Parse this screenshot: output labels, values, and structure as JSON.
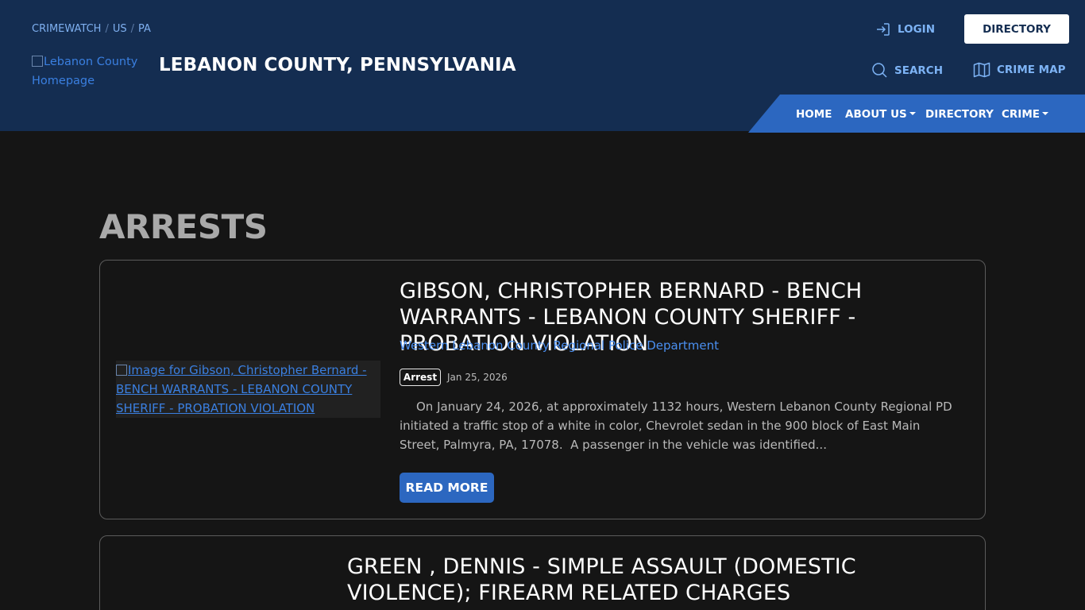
{
  "header": {
    "breadcrumb": [
      "CRIMEWATCH",
      "US",
      "PA"
    ],
    "breadcrumb_sep": "/",
    "logo_alt": "Lebanon County Homepage",
    "site_title": "LEBANON COUNTY, PENNSYLVANIA",
    "login_label": "LOGIN",
    "directory_button": "DIRECTORY",
    "search_label": "SEARCH",
    "crime_map_label": "CRIME MAP"
  },
  "nav": {
    "items": [
      "HOME",
      "ABOUT US",
      "DIRECTORY",
      "CRIME"
    ]
  },
  "colors": {
    "header_bg": "#142d51",
    "accent_blue": "#2c67c0",
    "link_blue": "#4a8ff0",
    "page_bg": "#151515"
  },
  "main": {
    "heading": "ARRESTS",
    "cards": [
      {
        "image_alt": "Image for Gibson, Christopher Bernard - BENCH WARRANTS - LEBANON COUNTY SHERIFF - PROBATION VIOLATION",
        "title": "GIBSON, CHRISTOPHER BERNARD - BENCH WARRANTS - LEBANON COUNTY SHERIFF - PROBATION VIOLATION",
        "agency": "Western Lebanon County Regional Police Department",
        "badge": "Arrest",
        "date": "Jan 25, 2026",
        "excerpt": "On January 24, 2026, at approximately 1132 hours, Western Lebanon County Regional PD initiated a traffic stop of a white in color, Chevrolet sedan in the 900 block of East Main Street, Palmyra, PA, 17078.  A passenger in the vehicle was identified...",
        "read_more": "READ MORE"
      },
      {
        "title": "GREEN , DENNIS - SIMPLE ASSAULT (DOMESTIC VIOLENCE); FIREARM RELATED CHARGES"
      }
    ]
  }
}
